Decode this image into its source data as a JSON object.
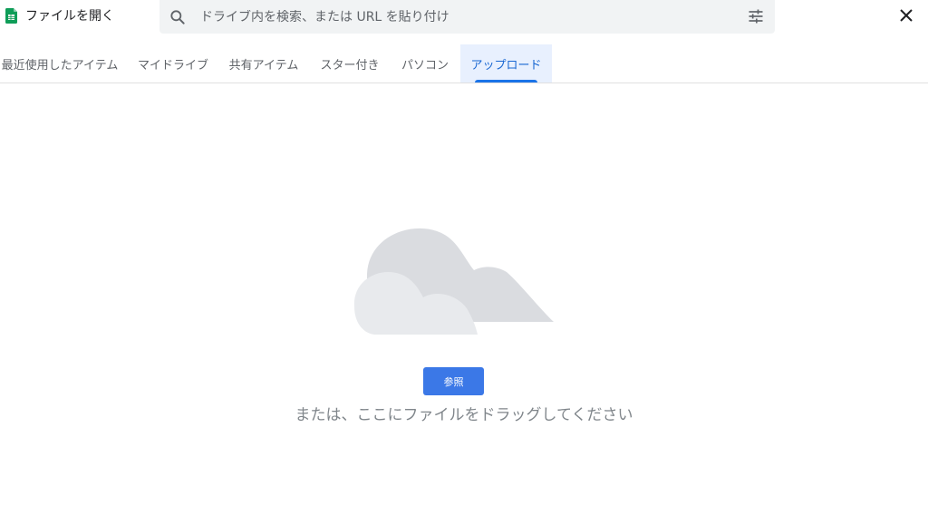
{
  "header": {
    "title": "ファイルを開く",
    "app_icon": "google-sheets-icon",
    "close_icon": "close-icon"
  },
  "search": {
    "placeholder": "ドライブ内を検索、または URL を貼り付け",
    "value": "",
    "search_icon": "search-icon",
    "filter_icon": "filter-options-icon"
  },
  "tabs": [
    {
      "label": "最近使用したアイテム",
      "active": false
    },
    {
      "label": "マイドライブ",
      "active": false
    },
    {
      "label": "共有アイテム",
      "active": false
    },
    {
      "label": "スター付き",
      "active": false
    },
    {
      "label": "パソコン",
      "active": false
    },
    {
      "label": "アップロード",
      "active": true
    }
  ],
  "upload": {
    "illustration": "cloud-illustration",
    "browse_label": "参照",
    "drag_hint": "または、ここにファイルをドラッグしてください"
  },
  "colors": {
    "accent": "#1a73e8",
    "button": "#3b78e7",
    "active_tab_bg": "#e8f0fe",
    "sheets_green": "#0f9d58",
    "cloud_back": "#dadce0",
    "cloud_front": "#e8eaed"
  }
}
